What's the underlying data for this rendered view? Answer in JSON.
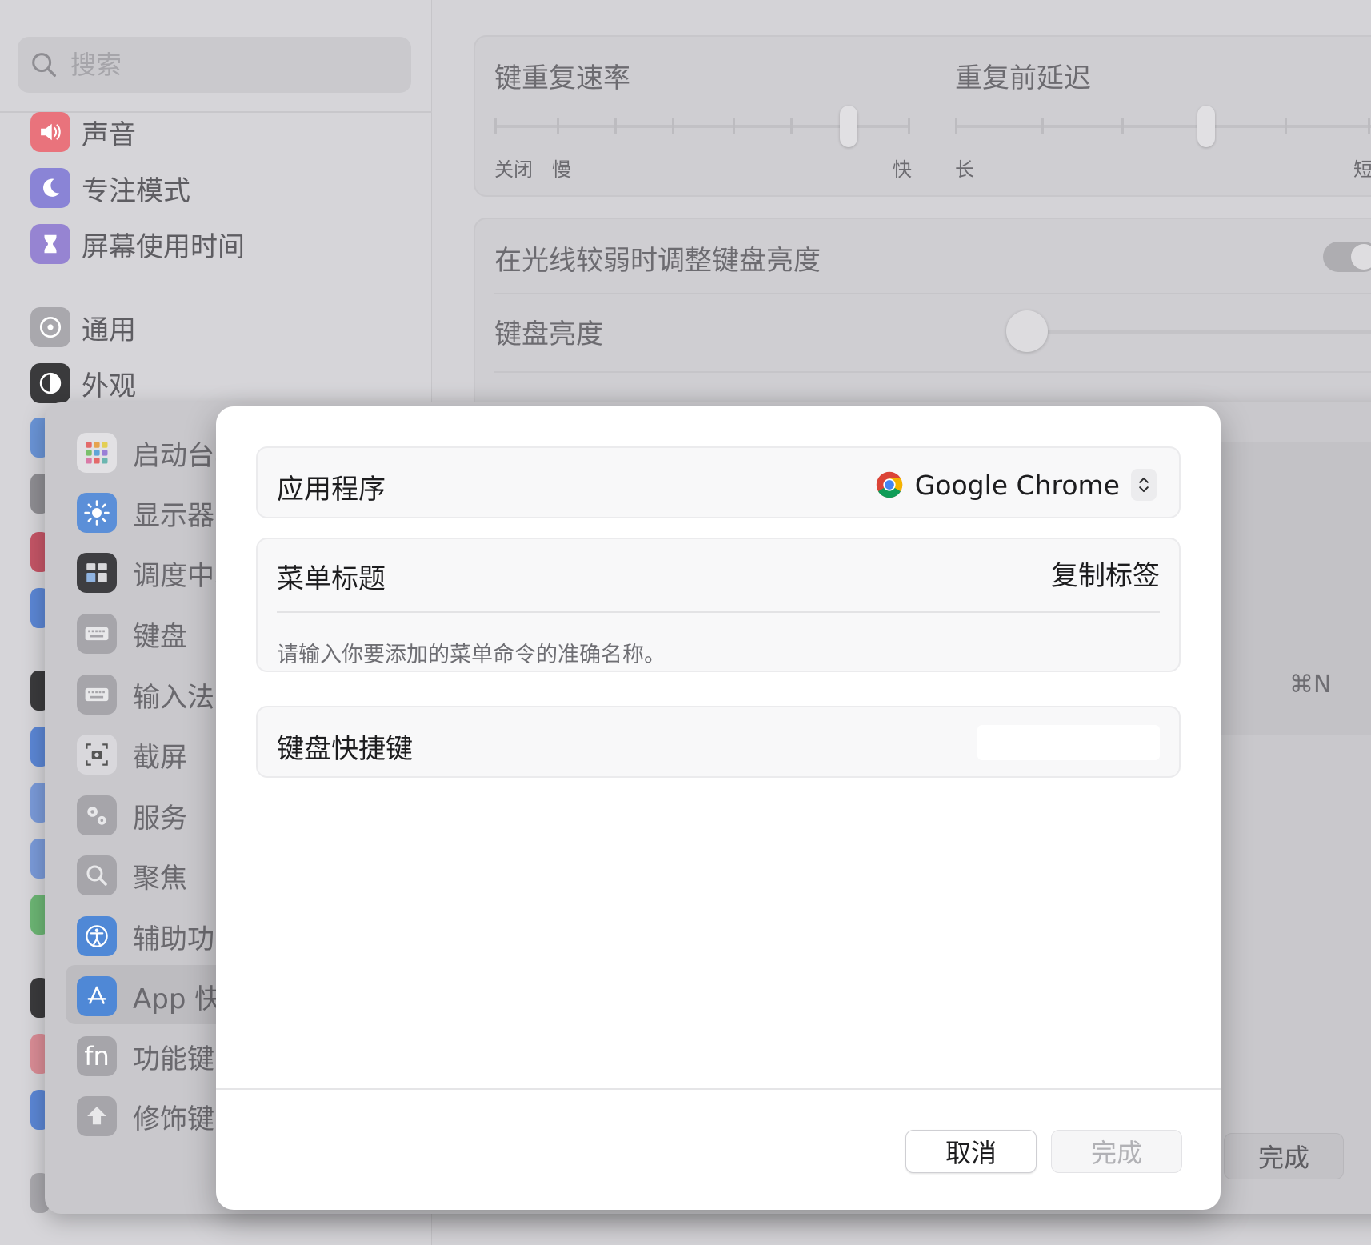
{
  "search": {
    "placeholder": "搜索"
  },
  "sidebar": {
    "items": [
      {
        "label": "声音",
        "icon": "speaker-icon",
        "color": "#e9737c"
      },
      {
        "label": "专注模式",
        "icon": "moon-icon",
        "color": "#8a84d6"
      },
      {
        "label": "屏幕使用时间",
        "icon": "hourglass-icon",
        "color": "#9684d2"
      },
      {
        "label": "通用",
        "icon": "gear-icon",
        "color": "#a9a8ad"
      },
      {
        "label": "外观",
        "icon": "appearance-icon",
        "color": "#3a3a3c"
      }
    ]
  },
  "keyboard": {
    "repeat_rate": {
      "title": "键重复速率",
      "label_off": "关闭",
      "label_slow": "慢",
      "label_fast": "快"
    },
    "repeat_delay": {
      "title": "重复前延迟",
      "label_long": "长",
      "label_short": "短"
    },
    "adjust_brightness": {
      "label": "在光线较弱时调整键盘亮度"
    },
    "brightness": {
      "label": "键盘亮度"
    }
  },
  "shortcuts_sheet": {
    "items": [
      {
        "label": "启动台与程序坞",
        "icon": "launchpad-icon"
      },
      {
        "label": "显示器",
        "icon": "display-icon"
      },
      {
        "label": "调度中心",
        "icon": "mission-control-icon"
      },
      {
        "label": "键盘",
        "icon": "keyboard-icon"
      },
      {
        "label": "输入法",
        "icon": "input-icon"
      },
      {
        "label": "截屏",
        "icon": "screenshot-icon"
      },
      {
        "label": "服务",
        "icon": "services-icon"
      },
      {
        "label": "聚焦",
        "icon": "spotlight-icon"
      },
      {
        "label": "辅助功能",
        "icon": "accessibility-icon"
      },
      {
        "label": "App 快捷键",
        "icon": "app-store-icon"
      },
      {
        "label": "功能键",
        "icon": "fn-icon"
      },
      {
        "label": "修饰键",
        "icon": "modifier-icon"
      }
    ],
    "shortcut_value": "⌘N",
    "done_label": "完成"
  },
  "dialog": {
    "application": {
      "label": "应用程序",
      "value": "Google Chrome"
    },
    "menu_title": {
      "label": "菜单标题",
      "value": "复制标签",
      "hint": "请输入你要添加的菜单命令的准确名称。"
    },
    "keyboard_shortcut": {
      "label": "键盘快捷键",
      "value": ""
    },
    "cancel_label": "取消",
    "done_label": "完成"
  }
}
